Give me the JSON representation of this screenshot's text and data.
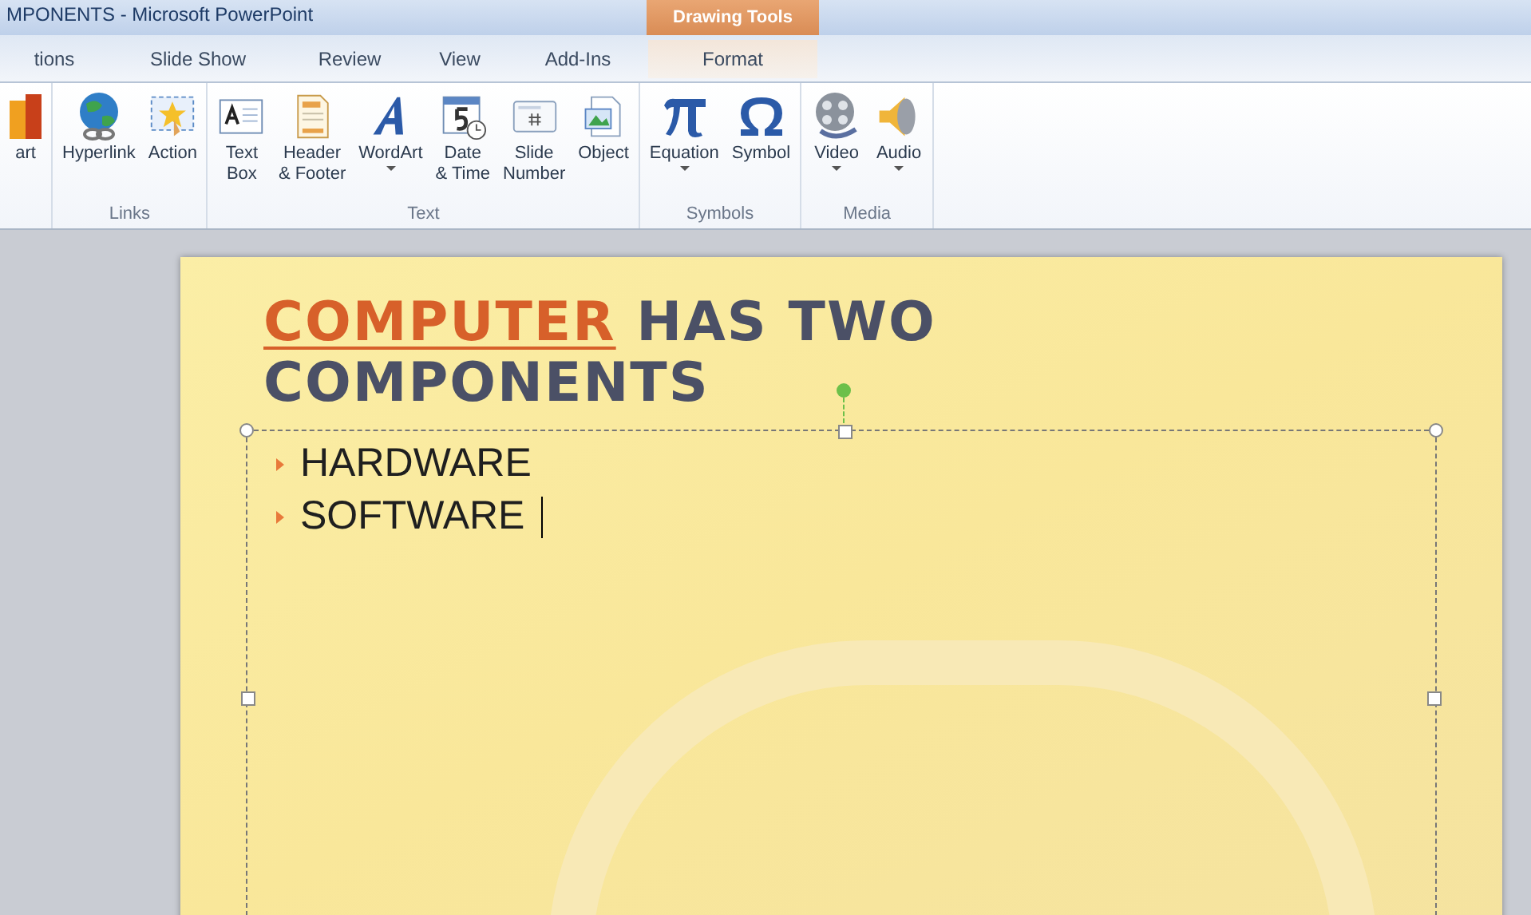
{
  "window": {
    "title": "MPONENTS - Microsoft PowerPoint",
    "context_tab_group": "Drawing Tools"
  },
  "tabs": [
    {
      "label": "tions",
      "selected": false,
      "kind": "standard"
    },
    {
      "label": "Slide Show",
      "selected": false,
      "kind": "standard"
    },
    {
      "label": "Review",
      "selected": false,
      "kind": "standard"
    },
    {
      "label": "View",
      "selected": false,
      "kind": "standard"
    },
    {
      "label": "Add-Ins",
      "selected": false,
      "kind": "standard"
    },
    {
      "label": "Format",
      "selected": false,
      "kind": "contextual"
    }
  ],
  "ribbon_groups": [
    {
      "buttons": [
        {
          "label": "art",
          "dropdown": false
        }
      ]
    },
    {
      "label": "Links",
      "buttons": [
        {
          "label": "Hyperlink",
          "dropdown": false
        },
        {
          "label": "Action",
          "dropdown": false
        }
      ]
    },
    {
      "label": "Text",
      "buttons": [
        {
          "label": "Text\nBox",
          "dropdown": false
        },
        {
          "label": "Header\n& Footer",
          "dropdown": false
        },
        {
          "label": "WordArt",
          "dropdown": true
        },
        {
          "label": "Date\n& Time",
          "dropdown": false
        },
        {
          "label": "Slide\nNumber",
          "dropdown": false
        },
        {
          "label": "Object",
          "dropdown": false
        }
      ]
    },
    {
      "label": "Symbols",
      "buttons": [
        {
          "label": "Equation",
          "dropdown": true
        },
        {
          "label": "Symbol",
          "dropdown": false
        }
      ]
    },
    {
      "label": "Media",
      "buttons": [
        {
          "label": "Video",
          "dropdown": true
        },
        {
          "label": "Audio",
          "dropdown": true
        }
      ]
    }
  ],
  "slide": {
    "title": {
      "highlight": "COMPUTER",
      "line_1_rest": "HAS TWO",
      "line_2": "COMPONENTS"
    },
    "bullets": [
      "HARDWARE",
      "SOFTWARE"
    ],
    "text_box_selected": true
  }
}
